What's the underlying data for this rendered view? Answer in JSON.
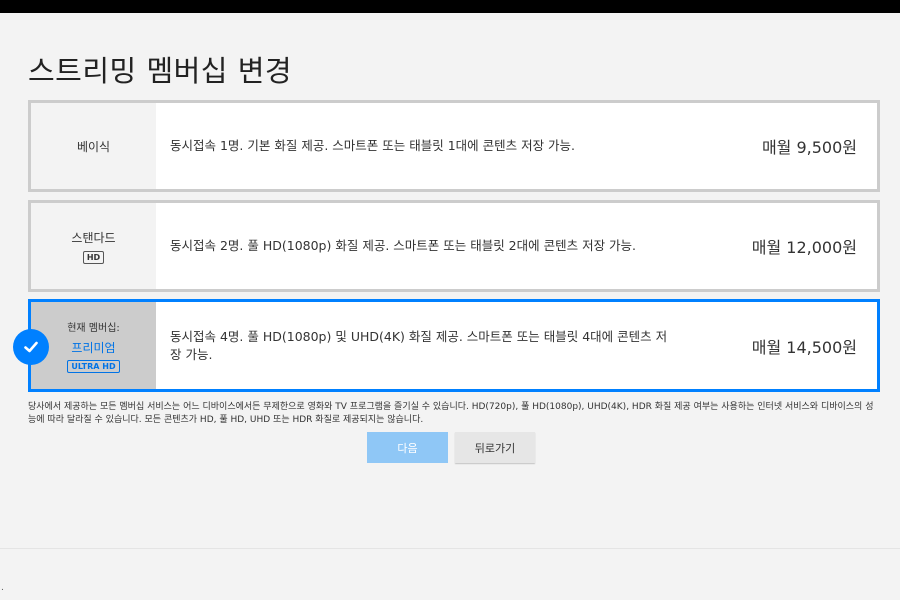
{
  "page": {
    "title": "스트리밍 멤버십 변경"
  },
  "plans": [
    {
      "name": "베이식",
      "description": "동시접속 1명. 기본 화질 제공. 스마트폰 또는 태블릿 1대에 콘텐츠 저장 가능.",
      "price": "매월 9,500원"
    },
    {
      "name": "스탠다드",
      "badge": "HD",
      "description": "동시접속 2명. 풀 HD(1080p) 화질 제공. 스마트폰 또는 태블릿 2대에 콘텐츠 저장 가능.",
      "price": "매월 12,000원"
    },
    {
      "current_label": "현재 멤버십:",
      "name": "프리미엄",
      "badge": "ULTRA HD",
      "description": "동시접속 4명. 풀 HD(1080p) 및 UHD(4K) 화질 제공. 스마트폰 또는 태블릿 4대에 콘텐츠 저장 가능.",
      "price": "매월 14,500원",
      "selected": true
    }
  ],
  "disclaimer": "당사에서 제공하는 모든 멤버십 서비스는 어느 디바이스에서든 무제한으로 영화와 TV 프로그램을 즐기실 수 있습니다. HD(720p), 풀 HD(1080p), UHD(4K), HDR 화질 제공 여부는 사용하는 인터넷 서비스와 디바이스의 성능에 따라 달라질 수 있습니다. 모든 콘텐츠가 HD, 풀 HD, UHD 또는 HDR 화질로 제공되지는 않습니다.",
  "buttons": {
    "next": "다음",
    "back": "뒤로가기"
  },
  "footer": {
    "dot": "."
  },
  "icons": {
    "selected": "checkmark-icon"
  },
  "colors": {
    "accent": "#0080ff",
    "next_button": "#8fc7f6",
    "badge_blue": "#0073e6"
  }
}
